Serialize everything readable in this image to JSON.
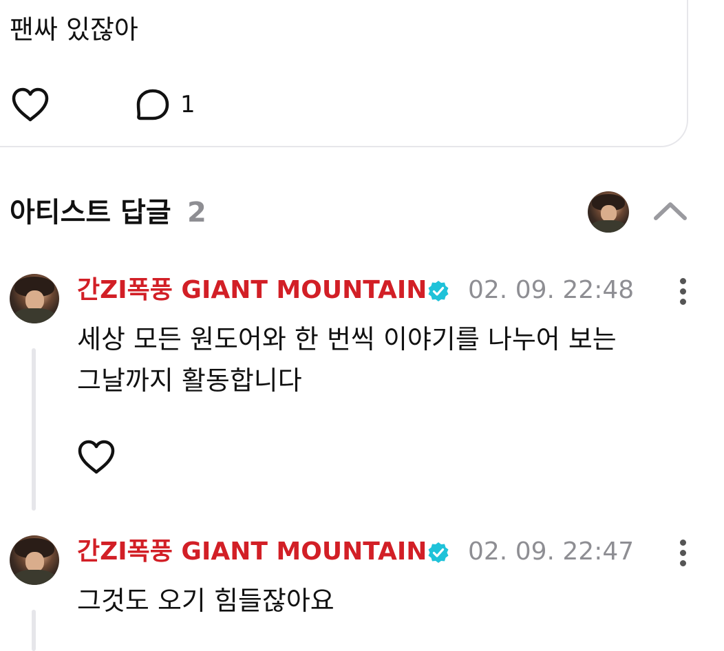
{
  "post": {
    "text": "팬싸 있잖아",
    "comment_count": "1",
    "like_icon": "heart-outline-icon",
    "comment_icon": "speech-bubble-icon"
  },
  "artist_replies": {
    "title": "아티스트 답글",
    "count": "2",
    "collapse_icon": "chevron-up-icon"
  },
  "replies": [
    {
      "author": "간ZI폭풍 GIANT MOUNTAIN",
      "verified_icon": "verified-badge-icon",
      "time": "02. 09. 22:48",
      "text_line1": "세상 모든 원도어와 한 번씩 이야기를 나누어 보는",
      "text_line2": "그날까지 활동합니다"
    },
    {
      "author": "간ZI폭풍 GIANT MOUNTAIN",
      "verified_icon": "verified-badge-icon",
      "time": "02. 09. 22:47",
      "text_line1": "그것도 오기 힘들잖아요"
    }
  ],
  "colors": {
    "artist_name": "#d21f26",
    "verified": "#1fc2d9",
    "muted": "#8e8e93",
    "divider": "#e6e6ea"
  }
}
